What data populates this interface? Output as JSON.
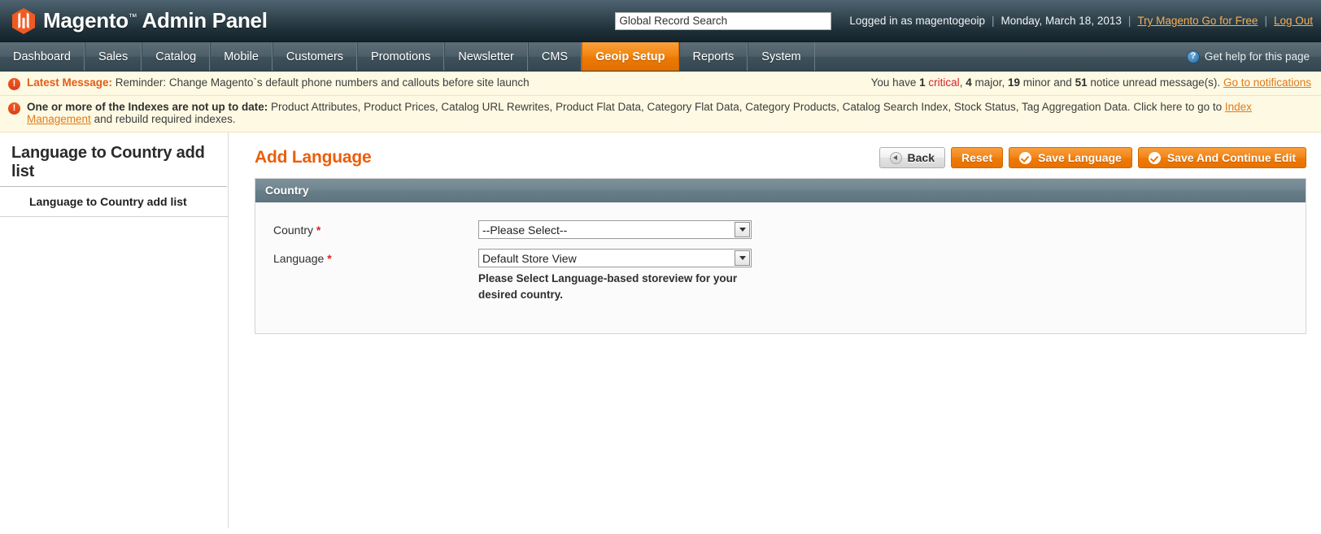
{
  "header": {
    "logo_text": "Magento",
    "logo_tm": "™",
    "logo_sub": "Admin Panel",
    "search_placeholder": "Global Record Search",
    "search_value": "Global Record Search",
    "logged_in": "Logged in as magentogeoip",
    "date": "Monday, March 18, 2013",
    "try_link": "Try Magento Go for Free",
    "logout_link": "Log Out",
    "sep": "|"
  },
  "nav": {
    "items": [
      {
        "label": "Dashboard",
        "active": false
      },
      {
        "label": "Sales",
        "active": false
      },
      {
        "label": "Catalog",
        "active": false
      },
      {
        "label": "Mobile",
        "active": false
      },
      {
        "label": "Customers",
        "active": false
      },
      {
        "label": "Promotions",
        "active": false
      },
      {
        "label": "Newsletter",
        "active": false
      },
      {
        "label": "CMS",
        "active": false
      },
      {
        "label": "Geoip Setup",
        "active": true
      },
      {
        "label": "Reports",
        "active": false
      },
      {
        "label": "System",
        "active": false
      }
    ],
    "help_label": "Get help for this page",
    "help_icon": "question-circle-icon"
  },
  "messages": {
    "latest": {
      "icon": "warning-icon",
      "label": "Latest Message:",
      "text": " Reminder: Change Magento`s default phone numbers and callouts before site launch",
      "counts_prefix": "You have ",
      "critical_count": "1",
      "critical_word": " critical",
      "major_count": "4",
      "major_word": " major, ",
      "minor_count": "19",
      "minor_word": " minor and ",
      "notice_count": "51",
      "notice_word": " notice unread message(s). ",
      "notifications_link": "Go to notifications",
      "comma": ", "
    },
    "index": {
      "icon": "warning-icon",
      "label": "One or more of the Indexes are not up to date:",
      "text": " Product Attributes, Product Prices, Catalog URL Rewrites, Product Flat Data, Category Flat Data, Category Products, Catalog Search Index, Stock Status, Tag Aggregation Data. Click here to go to ",
      "link": "Index Management",
      "text_after": " and rebuild required indexes."
    }
  },
  "sidebar": {
    "title": "Language to Country add list",
    "items": [
      {
        "label": "Language to Country add list"
      }
    ]
  },
  "main": {
    "page_title": "Add Language",
    "buttons": {
      "back": "Back",
      "back_icon": "back-arrow-icon",
      "reset": "Reset",
      "save": "Save Language",
      "save_icon": "check-circle-icon",
      "save_continue": "Save And Continue Edit",
      "save_continue_icon": "check-circle-icon"
    },
    "panel": {
      "heading": "Country",
      "fields": [
        {
          "label": "Country",
          "required": "*",
          "value": "--Please Select--",
          "note": ""
        },
        {
          "label": "Language",
          "required": "*",
          "value": "Default Store View",
          "note": "Please Select Language-based storeview for your desired country."
        }
      ]
    }
  },
  "colors": {
    "accent_orange": "#eb5e0b",
    "header_dark": "#1f3039",
    "nav_slate": "#4c5e68",
    "panel_head": "#6f858f",
    "message_bg": "#fdf9e3",
    "link_orange": "#e07b1a",
    "critical_red": "#d8232a"
  }
}
